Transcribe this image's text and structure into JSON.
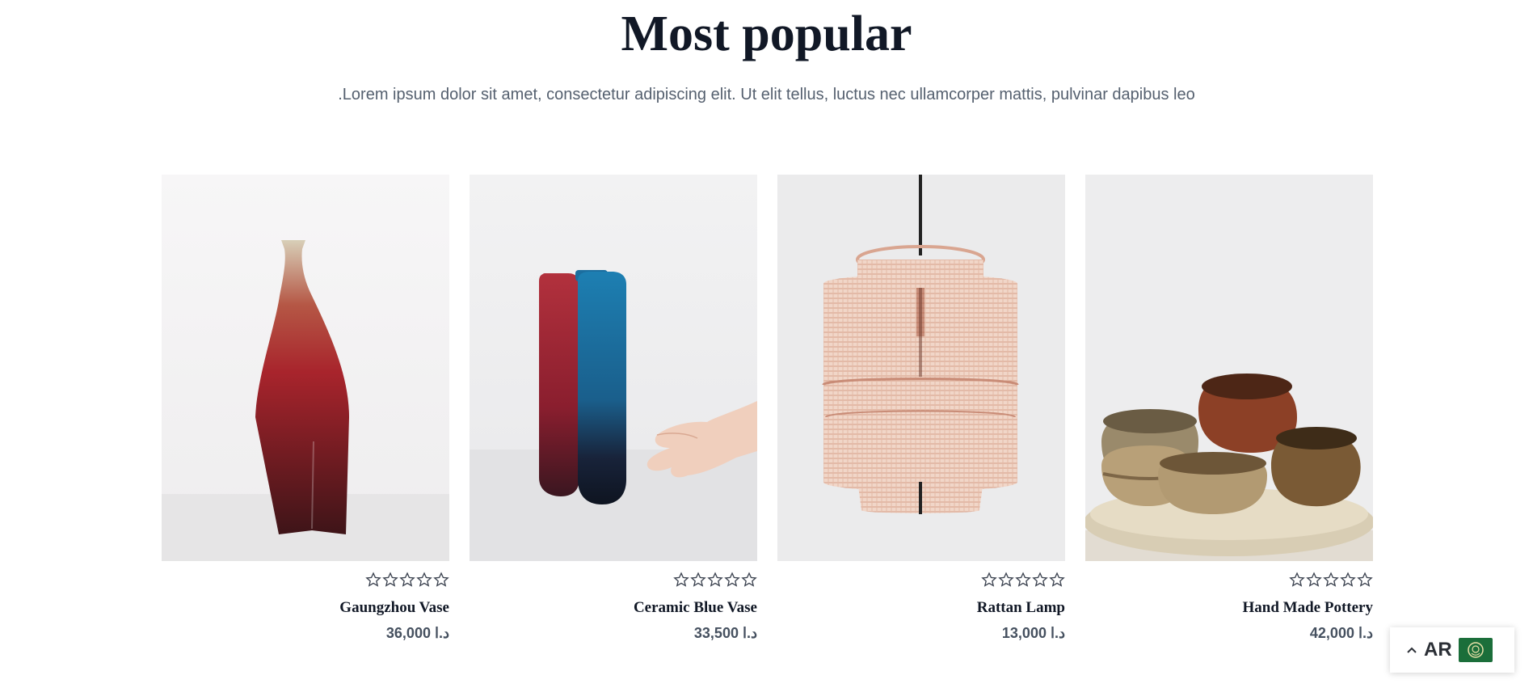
{
  "section": {
    "title": "Most popular",
    "subtitle": ".Lorem ipsum dolor sit amet, consectetur adipiscing elit. Ut elit tellus, luctus nec ullamcorper mattis, pulvinar dapibus leo"
  },
  "products": [
    {
      "name": "Gaungzhou Vase",
      "price": "د.ا 36,000",
      "rating": 0,
      "image": "red vase"
    },
    {
      "name": "Ceramic Blue Vase",
      "price": "د.ا 33,500",
      "rating": 0,
      "image": "blue vase held by hand"
    },
    {
      "name": "Rattan Lamp",
      "price": "د.ا 13,000",
      "rating": 0,
      "image": "rattan pendant lamp"
    },
    {
      "name": "Hand Made Pottery",
      "price": "د.ا 42,000",
      "rating": 0,
      "image": "clay bowls on tray"
    }
  ],
  "language_switcher": {
    "code": "AR",
    "icon": "chevron-up-icon",
    "flag": "arab-league-flag"
  },
  "colors": {
    "title": "#111826",
    "text": "#55606f",
    "price": "#45505f",
    "flag": "#1b6e3a"
  }
}
